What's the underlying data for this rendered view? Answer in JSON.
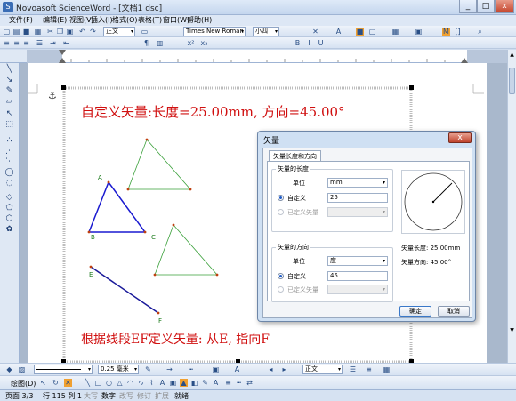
{
  "window": {
    "title": "Novoasoft ScienceWord - [文档1 dsc]",
    "min": "_",
    "max": "□",
    "close": "x"
  },
  "menu": [
    "文件(F)",
    "编辑(E)",
    "视图(V)",
    "插入(I)",
    "格式(O)",
    "表格(T)",
    "窗口(W)",
    "帮助(H)"
  ],
  "toolbar": {
    "style": "正文",
    "font": "Times New Roman",
    "size": "小四"
  },
  "page": {
    "heading": "自定义矢量:长度=25.00mm, 方向=45.00°",
    "footer": "根据线段EF定义矢量: 从E, 指向F",
    "point_labels": [
      "A",
      "B",
      "C",
      "E",
      "F"
    ]
  },
  "dialog": {
    "title": "矢量",
    "close": "x",
    "tab": "矢量长度和方向",
    "length_group": "矢量的长度",
    "unit_label": "单位",
    "length_unit": "mm",
    "custom_label": "自定义",
    "length_value": "25",
    "defined_label": "已定义矢量",
    "direction_group": "矢量的方向",
    "direction_unit": "度",
    "direction_value": "45",
    "length_readout": "矢量长度: 25.00mm",
    "direction_readout": "矢量方向: 45.00°",
    "ok": "确定",
    "cancel": "取消"
  },
  "bottom": {
    "line_width": "0.25 毫米",
    "style2": "正文",
    "draw_label": "绘图(D)"
  },
  "status": {
    "page": "页面 3/3",
    "pos": "行 115 列 1",
    "mode1": "大写",
    "mode2": "数字",
    "mode3": "改写",
    "mode4": "修订",
    "mode5": "扩展",
    "ready": "就绪"
  },
  "colors": {
    "heading": "#d01010",
    "triangle_abc": "#1a1ad0",
    "triangle_green": "#3aa03a",
    "segment_ef": "#1a1a9a",
    "vertex": "#c04010"
  }
}
